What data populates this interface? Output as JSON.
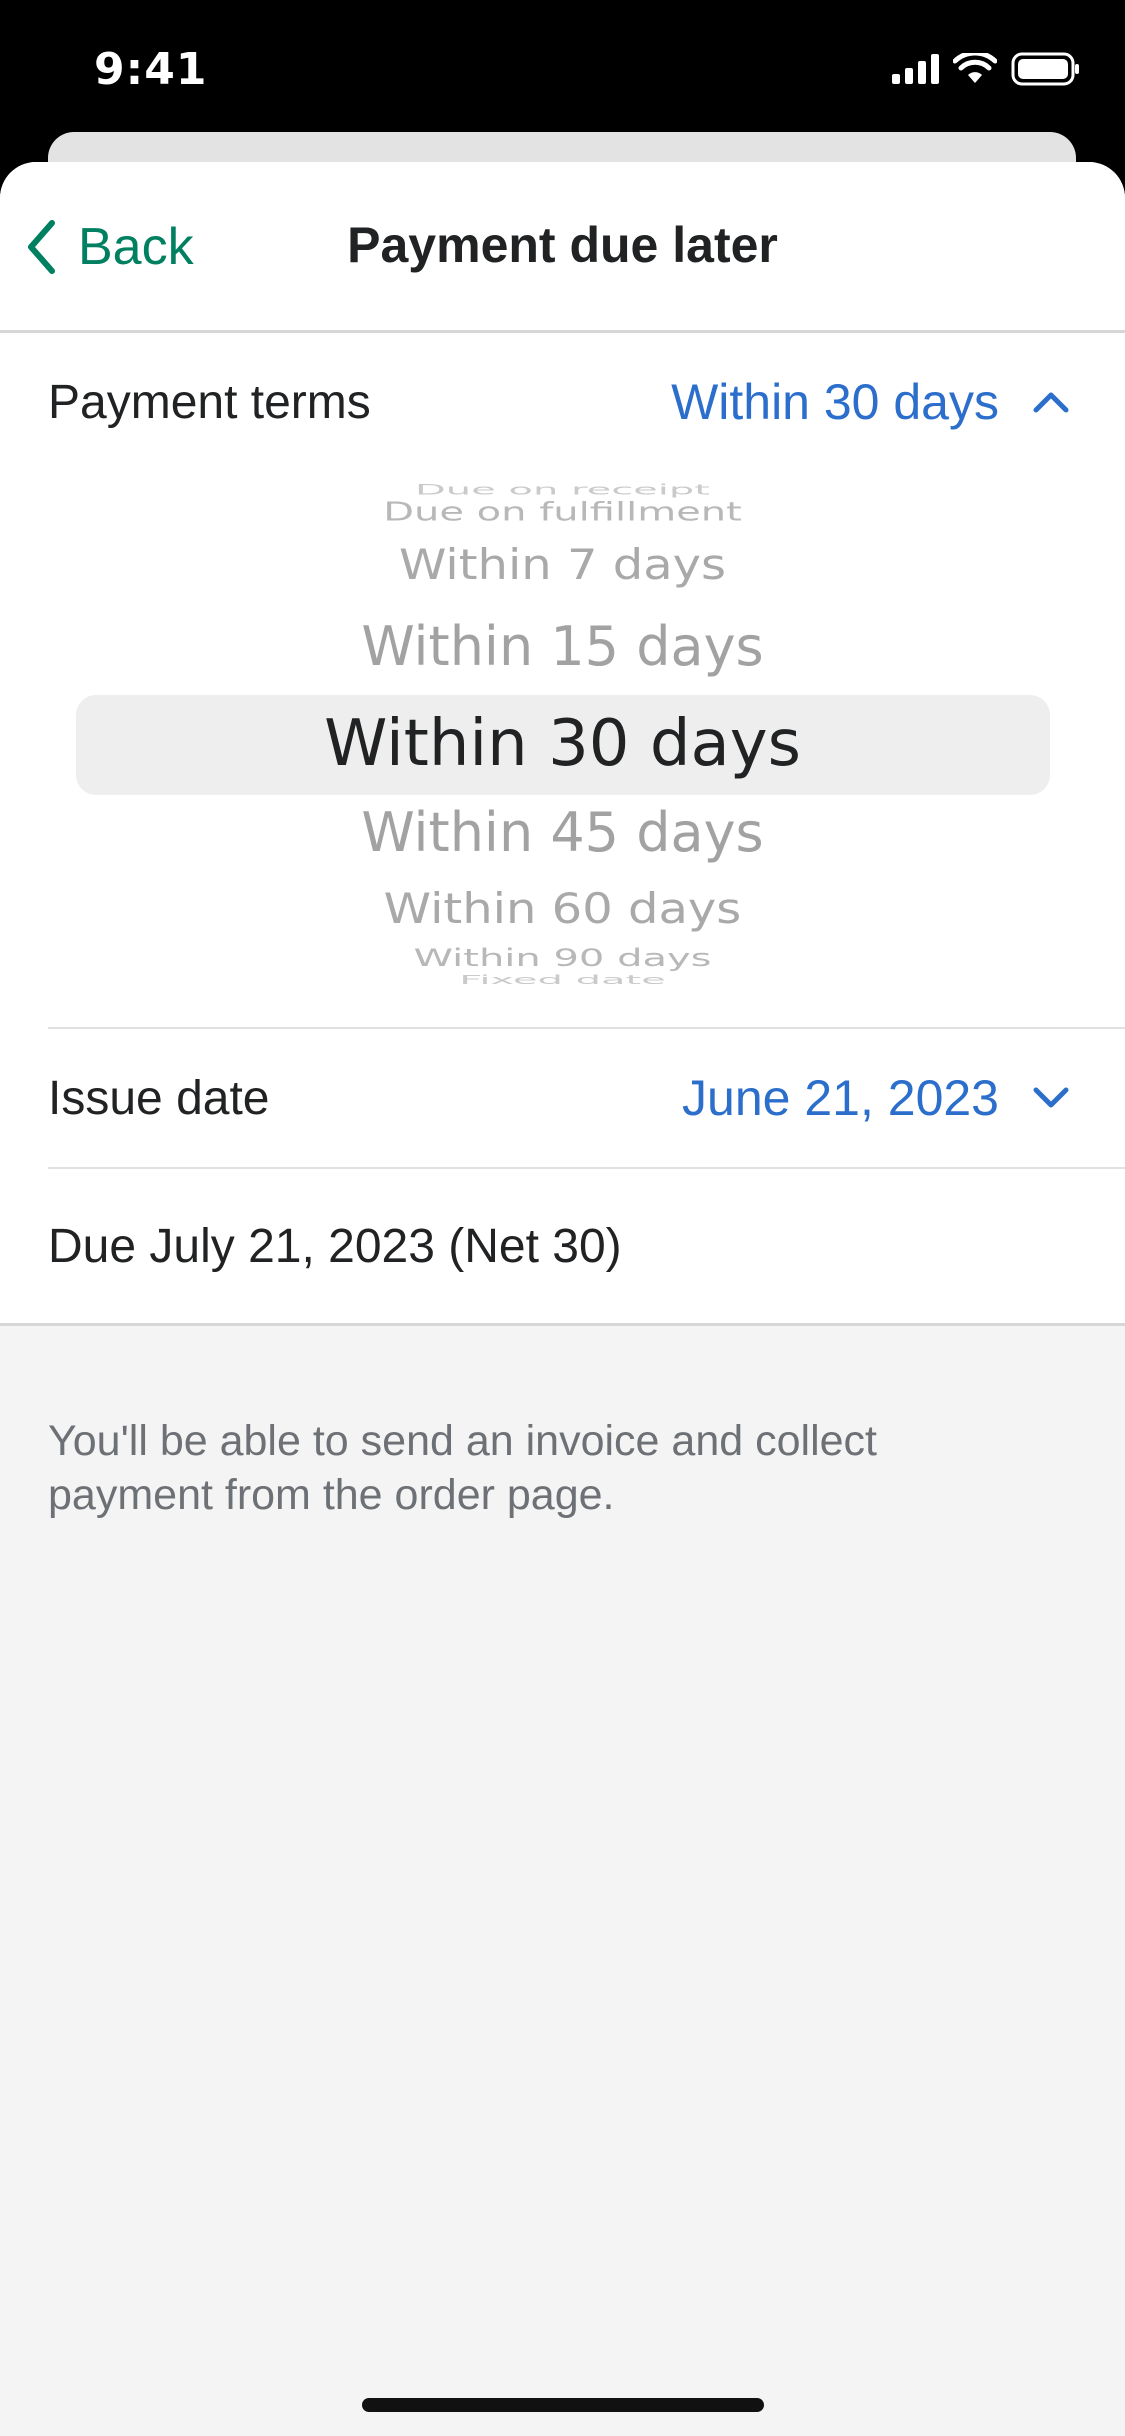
{
  "status_bar": {
    "time": "9:41"
  },
  "nav": {
    "back_label": "Back",
    "title": "Payment due later"
  },
  "payment_terms": {
    "label": "Payment terms",
    "value": "Within 30 days",
    "picker_options": [
      "Due on receipt",
      "Due on fulfillment",
      "Within 7 days",
      "Within 15 days",
      "Within 30 days",
      "Within 45 days",
      "Within 60 days",
      "Within 90 days",
      "Fixed date"
    ],
    "selected_option": "Within 30 days"
  },
  "issue_date": {
    "label": "Issue date",
    "value": "June 21, 2023"
  },
  "due_text": "Due July 21, 2023 (Net 30)",
  "help_text": "You'll be able to send an invoice and collect payment from the order page.",
  "colors": {
    "accent_green": "#008060",
    "link_blue": "#2c6ecb"
  }
}
